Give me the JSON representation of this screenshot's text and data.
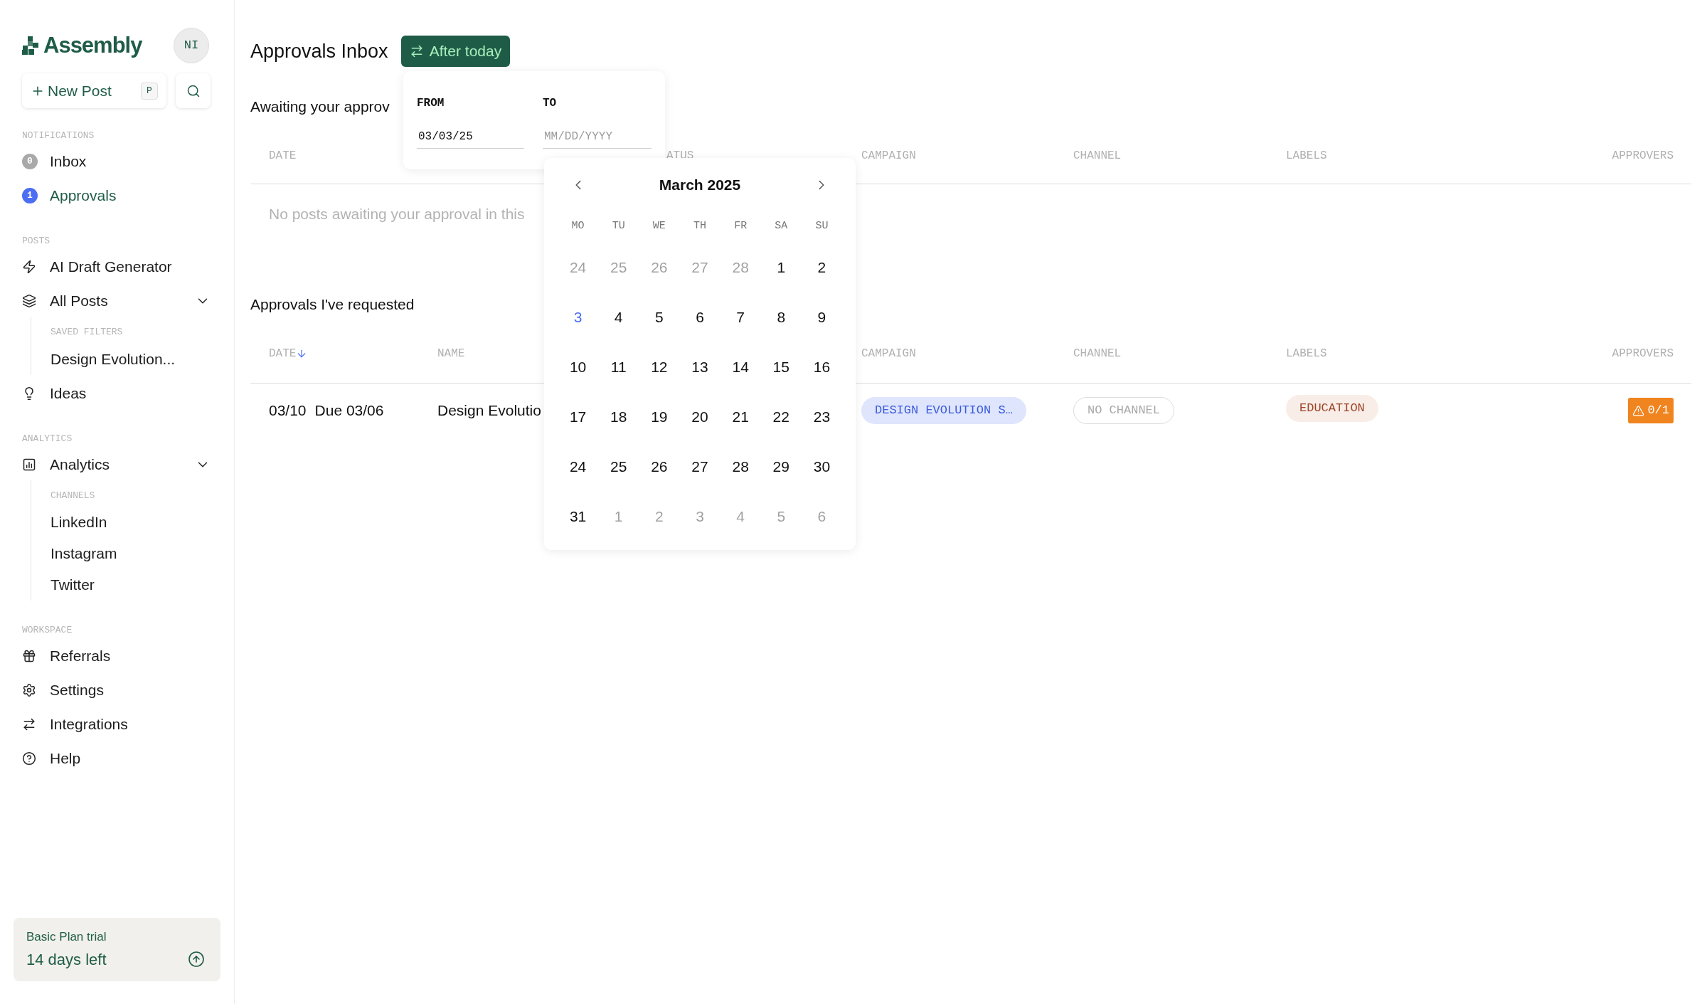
{
  "sidebar": {
    "logo": "Assembly",
    "avatar": "NI",
    "new_post": {
      "label": "New Post",
      "shortcut": "P"
    },
    "sections": [
      {
        "title": "NOTIFICATIONS",
        "items": [
          {
            "label": "Inbox",
            "badge": "0",
            "color": "#a9a9a9",
            "selected": false
          },
          {
            "label": "Approvals",
            "badge": "1",
            "color": "#4c6ef5",
            "selected": true
          }
        ]
      },
      {
        "title": "POSTS",
        "items": [
          {
            "label": "AI Draft Generator",
            "selected": false
          },
          {
            "label": "All Posts",
            "selected": false,
            "expanded": true,
            "group": {
              "title": "SAVED FILTERS",
              "children": [
                {
                  "label": "Design Evolution...",
                  "selected": false
                }
              ]
            }
          },
          {
            "label": "Ideas",
            "selected": false
          }
        ]
      },
      {
        "title": "ANALYTICS",
        "items": [
          {
            "label": "Analytics",
            "selected": false,
            "expanded": true,
            "group": {
              "title": "CHANNELS",
              "children": [
                {
                  "label": "LinkedIn",
                  "selected": false
                },
                {
                  "label": "Instagram",
                  "selected": false
                },
                {
                  "label": "Twitter",
                  "selected": false
                }
              ]
            }
          }
        ]
      },
      {
        "title": "WORKSPACE",
        "items": [
          {
            "label": "Referrals",
            "selected": false
          },
          {
            "label": "Settings",
            "selected": false
          },
          {
            "label": "Integrations",
            "selected": false
          },
          {
            "label": "Help",
            "selected": false
          }
        ]
      }
    ],
    "plan": {
      "title": "Basic Plan trial",
      "days": "14 days left"
    }
  },
  "main": {
    "title": "Approvals Inbox",
    "filter_button": "After today",
    "awaiting": {
      "title": "Awaiting your approv",
      "columns": [
        {
          "label": "DATE",
          "sorted": false
        },
        {
          "label": "ATUS",
          "sorted": false
        },
        {
          "label": "CAMPAIGN",
          "sorted": false
        },
        {
          "label": "CHANNEL",
          "sorted": false
        },
        {
          "label": "LABELS",
          "sorted": false
        },
        {
          "label": "APPROVERS",
          "sorted": false
        }
      ],
      "empty": "No posts awaiting your approval in this"
    },
    "requested": {
      "title": "Approvals I've requested",
      "columns": [
        {
          "label": "DATE",
          "sorted": true
        },
        {
          "label": "NAME",
          "sorted": false
        },
        {
          "label": "CAMPAIGN",
          "sorted": false
        },
        {
          "label": "CHANNEL",
          "sorted": false
        },
        {
          "label": "LABELS",
          "sorted": false
        },
        {
          "label": "APPROVERS",
          "sorted": false
        }
      ],
      "rows": [
        {
          "date": "03/10",
          "due": "Due 03/06",
          "name": "Design Evolutio",
          "campaign": "DESIGN EVOLUTION S…",
          "channel": "NO CHANNEL",
          "label": "EDUCATION",
          "approvers": "0/1"
        }
      ]
    }
  },
  "date_picker": {
    "from_label": "FROM",
    "from_value": "03/03/25",
    "to_label": "TO",
    "to_placeholder": "MM/DD/YYYY",
    "calendar": {
      "month": "March 2025",
      "weekdays": [
        "MO",
        "TU",
        "WE",
        "TH",
        "FR",
        "SA",
        "SU"
      ],
      "days": [
        {
          "label": "24",
          "outside": true,
          "selected": false
        },
        {
          "label": "25",
          "outside": true,
          "selected": false
        },
        {
          "label": "26",
          "outside": true,
          "selected": false
        },
        {
          "label": "27",
          "outside": true,
          "selected": false
        },
        {
          "label": "28",
          "outside": true,
          "selected": false
        },
        {
          "label": "1",
          "outside": false,
          "selected": false
        },
        {
          "label": "2",
          "outside": false,
          "selected": false
        },
        {
          "label": "3",
          "outside": false,
          "selected": true
        },
        {
          "label": "4",
          "outside": false,
          "selected": false
        },
        {
          "label": "5",
          "outside": false,
          "selected": false
        },
        {
          "label": "6",
          "outside": false,
          "selected": false
        },
        {
          "label": "7",
          "outside": false,
          "selected": false
        },
        {
          "label": "8",
          "outside": false,
          "selected": false
        },
        {
          "label": "9",
          "outside": false,
          "selected": false
        },
        {
          "label": "10",
          "outside": false,
          "selected": false
        },
        {
          "label": "11",
          "outside": false,
          "selected": false
        },
        {
          "label": "12",
          "outside": false,
          "selected": false
        },
        {
          "label": "13",
          "outside": false,
          "selected": false
        },
        {
          "label": "14",
          "outside": false,
          "selected": false
        },
        {
          "label": "15",
          "outside": false,
          "selected": false
        },
        {
          "label": "16",
          "outside": false,
          "selected": false
        },
        {
          "label": "17",
          "outside": false,
          "selected": false
        },
        {
          "label": "18",
          "outside": false,
          "selected": false
        },
        {
          "label": "19",
          "outside": false,
          "selected": false
        },
        {
          "label": "20",
          "outside": false,
          "selected": false
        },
        {
          "label": "21",
          "outside": false,
          "selected": false
        },
        {
          "label": "22",
          "outside": false,
          "selected": false
        },
        {
          "label": "23",
          "outside": false,
          "selected": false
        },
        {
          "label": "24",
          "outside": false,
          "selected": false
        },
        {
          "label": "25",
          "outside": false,
          "selected": false
        },
        {
          "label": "26",
          "outside": false,
          "selected": false
        },
        {
          "label": "27",
          "outside": false,
          "selected": false
        },
        {
          "label": "28",
          "outside": false,
          "selected": false
        },
        {
          "label": "29",
          "outside": false,
          "selected": false
        },
        {
          "label": "30",
          "outside": false,
          "selected": false
        },
        {
          "label": "31",
          "outside": false,
          "selected": false
        },
        {
          "label": "1",
          "outside": true,
          "selected": false
        },
        {
          "label": "2",
          "outside": true,
          "selected": false
        },
        {
          "label": "3",
          "outside": true,
          "selected": false
        },
        {
          "label": "4",
          "outside": true,
          "selected": false
        },
        {
          "label": "5",
          "outside": true,
          "selected": false
        },
        {
          "label": "6",
          "outside": true,
          "selected": false
        }
      ]
    }
  }
}
